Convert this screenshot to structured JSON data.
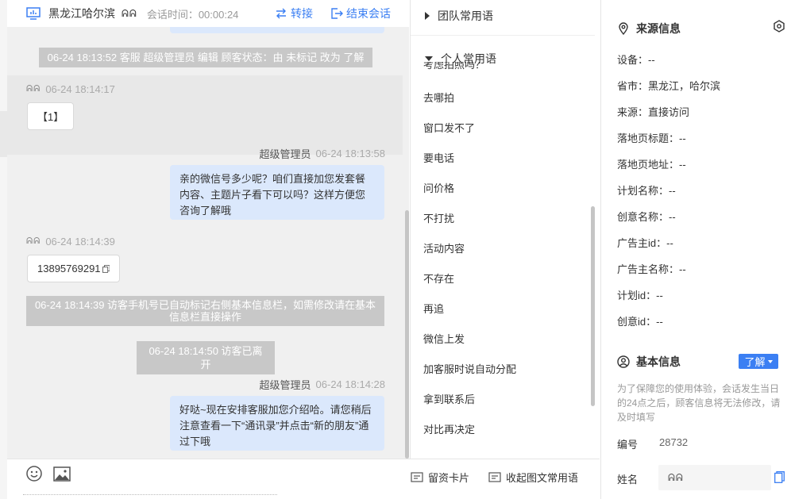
{
  "header": {
    "title": "黑龙江哈尔滨",
    "masks": "ᕱᕱ",
    "timer_label": "会话时间：00:00:24",
    "transfer_label": "转接",
    "end_label": "结束会话"
  },
  "messages": {
    "sys1": "06-24 18:13:52 客服 超级管理员 编辑 顾客状态：由 未标记 改为 了解",
    "m1_meta": "06-24 18:14:17",
    "m1_text": "【1】",
    "m2_sender": "超级管理员",
    "m2_time": "06-24 18:13:58",
    "m2_text": "亲的微信号多少呢？咱们直接加您发套餐内容、主题片子看下可以吗？这样方便您咨询了解哦",
    "m3_meta": "06-24 18:14:39",
    "m3_text": "13895769291",
    "sys2": "06-24 18:14:39 访客手机号已自动标记右侧基本信息栏，如需修改请在基本信息栏直接操作",
    "sys3": "06-24 18:14:50 访客已离开",
    "m4_sender": "超级管理员",
    "m4_time": "06-24 18:14:28",
    "m4_text": "好哒~现在安排客服加您介绍哈。请您稍后注意查看一下“通讯录”并点击“新的朋友”通过下哦"
  },
  "toolbar": {
    "card_label": "留资卡片",
    "collapse_label": "收起图文常用语"
  },
  "phrases": {
    "team_label": "团队常用语",
    "personal_label": "个人常用语",
    "clipped_item": "考虑拍照吗？",
    "items": [
      "去哪拍",
      "窗口发不了",
      "要电话",
      "问价格",
      "不打扰",
      "活动内容",
      "不存在",
      "再追",
      "微信上发",
      "加客服时说自动分配",
      "拿到联系后",
      "对比再决定"
    ]
  },
  "source": {
    "title": "来源信息",
    "rows": [
      "设备：--",
      "省市：黑龙江，哈尔滨",
      "来源：直接访问",
      "落地页标题：--",
      "落地页地址：--",
      "计划名称：--",
      "创意名称：--",
      "广告主id：--",
      "广告主名称：--",
      "计划id：--",
      "创意id：--"
    ]
  },
  "basic": {
    "title": "基本信息",
    "learn_label": "了解",
    "hint": "为了保障您的使用体验，会话发生当日的24点之后，顾客信息将无法修改，请及时填写",
    "id_label": "编号",
    "id_value": "28732",
    "name_label": "姓名",
    "name_value": "ᕱᕱ"
  },
  "colors": {
    "accent": "#3b7ff3",
    "bubble_out": "#dbe8fc",
    "system_note": "#c8c8c8"
  }
}
